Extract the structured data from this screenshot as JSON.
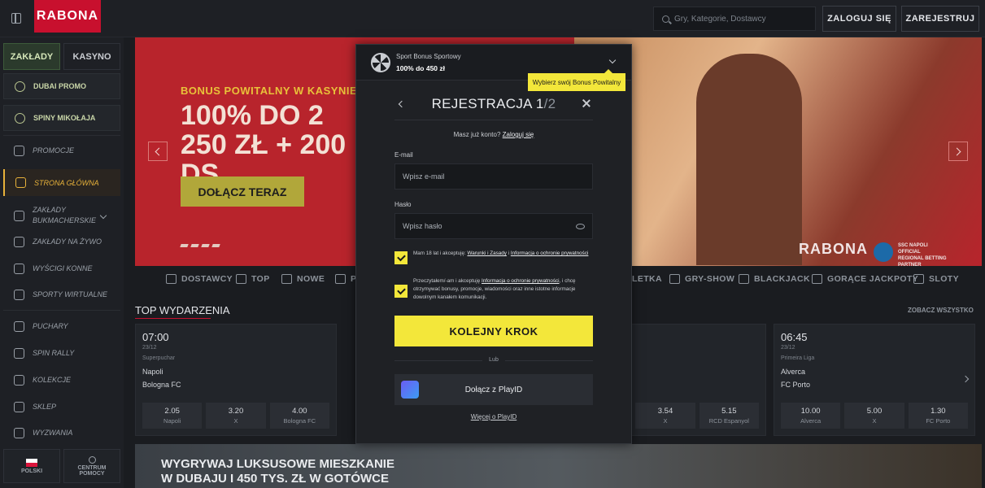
{
  "header": {
    "logo": "RABONA",
    "search_placeholder": "Gry, Kategorie, Dostawcy",
    "login": "ZALOGUJ SIĘ",
    "register": "ZAREJESTRUJ"
  },
  "sidebar": {
    "tabs": [
      "ZAKŁADY",
      "KASYNO"
    ],
    "promo_items": [
      "DUBAI PROMO",
      "SPINY MIKOŁAJA"
    ],
    "items": [
      "PROMOCJE",
      "STRONA GŁÓWNA",
      "ZAKŁADY BUKMACHERSKIE",
      "ZAKŁADY NA ŻYWO",
      "WYŚCIGI KONNE",
      "SPORTY WIRTUALNE",
      "PUCHARY",
      "SPIN RALLY",
      "KOLEKCJE",
      "SKLEP",
      "WYZWANIA"
    ],
    "footer": {
      "language": "POLSKI",
      "help": "CENTRUM POMOCY"
    }
  },
  "hero": {
    "kicker": "BONUS POWITALNY W KASYNIE",
    "title": "100% DO 2 250 ZŁ + 200 DS",
    "cta": "DOŁĄCZ TERAZ",
    "brand": "RABONA",
    "partner": "SSC NAPOLI OFFICIAL REGIONAL BETTING PARTNER"
  },
  "categories": [
    "DOSTAWCY",
    "TOP",
    "NOWE",
    "P",
    "LETKA",
    "GRY-SHOW",
    "BLACKJACK",
    "GORĄCE JACKPOTY",
    "SLOTY"
  ],
  "events": {
    "title": "TOP WYDARZENIA",
    "see_all": "ZOBACZ WSZYSTKO",
    "cards": [
      {
        "time": "07:00",
        "date": "23/12",
        "league": "Superpuchar",
        "team1": "Napoli",
        "team2": "Bologna FC",
        "odds": [
          {
            "v": "2.05",
            "l": "Napoli"
          },
          {
            "v": "3.20",
            "l": "X"
          },
          {
            "v": "4.00",
            "l": "Bologna FC"
          }
        ]
      },
      {
        "time": "",
        "date": "",
        "league": "",
        "team1": "",
        "team2": "",
        "odds": [
          {
            "v": "",
            "l": ""
          },
          {
            "v": "3.54",
            "l": "X"
          },
          {
            "v": "5.15",
            "l": "RCD Espanyol"
          }
        ]
      },
      {
        "time": "06:45",
        "date": "23/12",
        "league": "Primeira Liga",
        "team1": "Alverca",
        "team2": "FC Porto",
        "odds": [
          {
            "v": "10.00",
            "l": "Alverca"
          },
          {
            "v": "5.00",
            "l": "X"
          },
          {
            "v": "1.30",
            "l": "FC Porto"
          }
        ]
      }
    ]
  },
  "bottom_banner": "WYGRYWAJ LUKSUSOWE MIESZKANIE W DUBAJU I 450 TYS. ZŁ W GOTÓWCE",
  "modal": {
    "bonus_name": "Sport Bonus Sportowy",
    "bonus_value": "100% do 450 zł",
    "tooltip": "Wybierz swój Bonus Powitalny",
    "title": "REJESTRACJA 1",
    "title_step": "/2",
    "have_account": "Masz już konto?",
    "login_link": "Zaloguj się",
    "email_label": "E-mail",
    "email_placeholder": "Wpisz e-mail",
    "password_label": "Hasło",
    "password_placeholder": "Wpisz hasło",
    "consent1_pre": "Mam 18 lat i akceptuję:",
    "consent1_link1": "Warunki i Zasady",
    "consent1_and": "i",
    "consent1_link2": "Informacja o ochronie prywatności",
    "consent2_pre": "Przeczytałem/-am i akceptuję",
    "consent2_link": "Informacja o ochronie prywatności",
    "consent2_post": ", i chcę otrzymywać bonusy, promocje, wiadomości oraz inne istotne informacje dowolnym kanałem komunikacji.",
    "next": "KOLEJNY KROK",
    "or": "Lub",
    "playid": "Dołącz z PlayID",
    "more_playid": "Więcej o PlayID"
  }
}
